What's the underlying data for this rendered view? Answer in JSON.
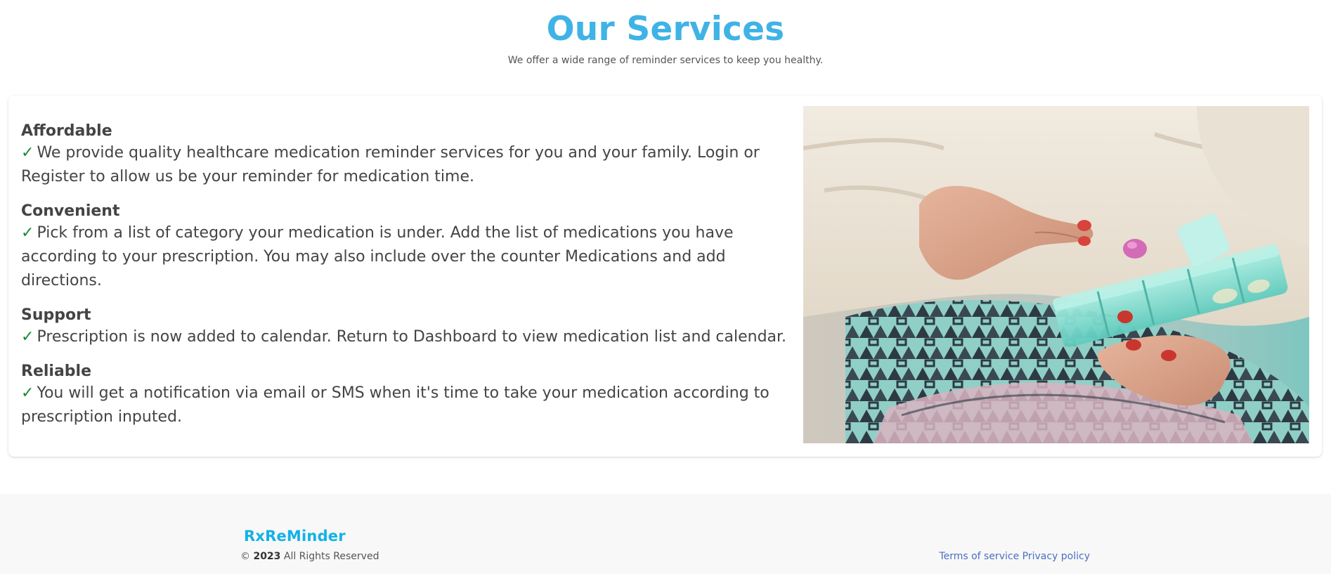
{
  "hero": {
    "title": "Our Services",
    "subtitle": "We offer a wide range of reminder services to keep you healthy."
  },
  "features": [
    {
      "title": "Affordable",
      "check": "✓",
      "text": "We provide quality healthcare medication reminder services for you and your family. Login or Register to allow us be your reminder for medication time."
    },
    {
      "title": "Convenient",
      "check": "✓",
      "text": "Pick from a list of category your medication is under. Add the list of medications you have according to your prescription. You may also include over the counter Medications and add directions."
    },
    {
      "title": "Support",
      "check": "✓",
      "text": "Prescription is now added to calendar. Return to Dashboard to view medication list and calendar."
    },
    {
      "title": "Reliable",
      "check": "✓",
      "text": "You will get a notification via email or SMS when it's time to take your medication according to prescription inputed."
    }
  ],
  "footer": {
    "brand": "RxReMinder",
    "copyright_symbol": "©",
    "year": "2023",
    "rights": "All Rights Reserved",
    "links": [
      "Terms of service",
      "Privacy policy"
    ]
  },
  "colors": {
    "accent": "#3fb3e6",
    "brand": "#13b2e6",
    "check": "#1a8a35",
    "link": "#4a6fc1"
  }
}
